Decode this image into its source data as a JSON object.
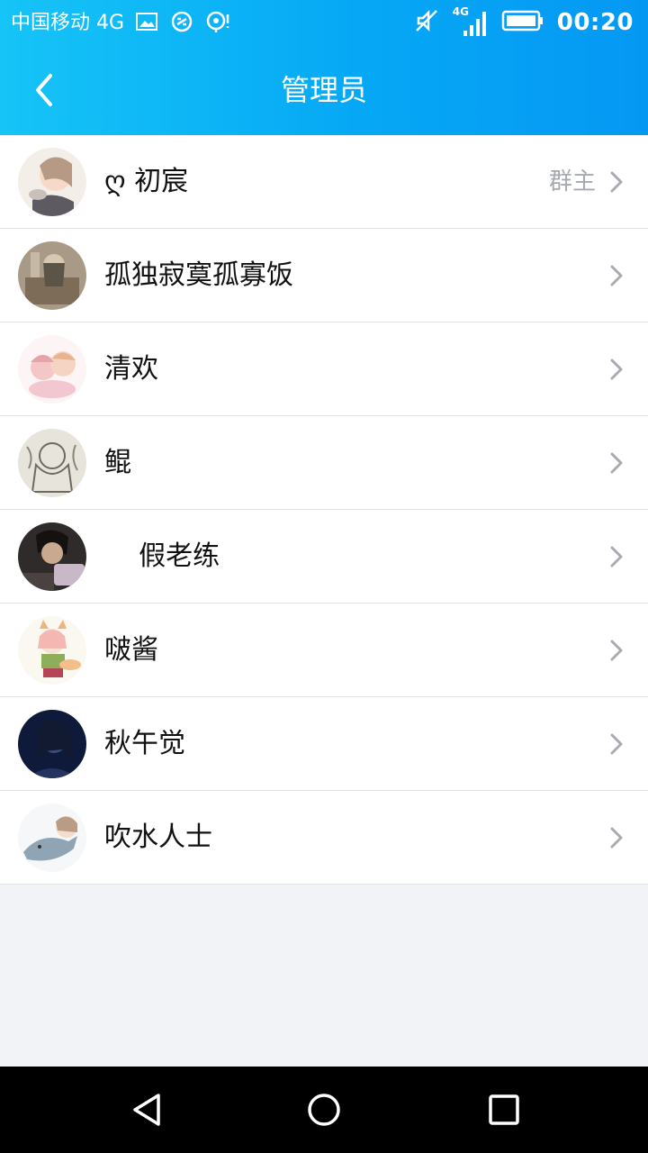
{
  "status_bar": {
    "carrier": "中国移动 4G",
    "network_badge": "4G",
    "time": "00:20",
    "icons": [
      "image-icon",
      "sync-icon",
      "hotspot-icon",
      "mute-icon",
      "signal-icon",
      "battery-icon"
    ]
  },
  "nav": {
    "title": "管理员",
    "back_icon": "chevron-left-icon"
  },
  "members": [
    {
      "name": "ღ 初宸",
      "role": "群主"
    },
    {
      "name": "孤独寂寞孤寡饭",
      "role": ""
    },
    {
      "name": "清欢",
      "role": ""
    },
    {
      "name": "鲲",
      "role": ""
    },
    {
      "name": "    假老练",
      "role": ""
    },
    {
      "name": "啵酱",
      "role": ""
    },
    {
      "name": "秋午觉",
      "role": ""
    },
    {
      "name": "吹水人士",
      "role": ""
    }
  ],
  "system_nav": {
    "icons": [
      "back-triangle-icon",
      "home-circle-icon",
      "recents-square-icon"
    ]
  },
  "colors": {
    "header_gradient_start": "#16c4f7",
    "header_gradient_end": "#0598f3",
    "role_text": "#a7a9b1",
    "background": "#f2f3f7"
  }
}
